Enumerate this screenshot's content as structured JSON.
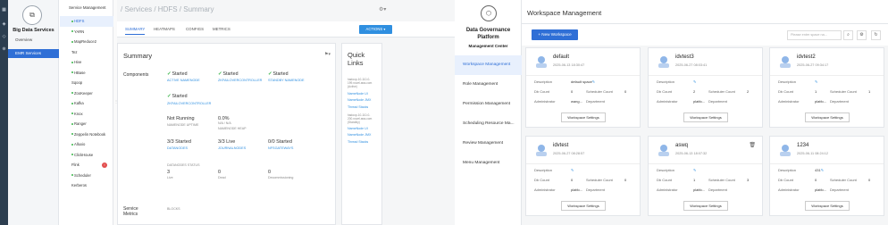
{
  "rail": {
    "icons": [
      "grid-icon",
      "layers-icon",
      "share-icon",
      "cluster-icon"
    ]
  },
  "bigdata": {
    "title": "Big Data Services",
    "nav": [
      {
        "label": "Overview"
      },
      {
        "label": "EMR Services"
      }
    ]
  },
  "services": {
    "heading": "Service Management",
    "items": [
      {
        "label": "HDFS",
        "dot": true
      },
      {
        "label": "YARN",
        "dot": true
      },
      {
        "label": "MapReduce2",
        "dot": true
      },
      {
        "label": "Tez",
        "dot": false
      },
      {
        "label": "Hive",
        "dot": true
      },
      {
        "label": "HBase",
        "dot": true
      },
      {
        "label": "Sqoop",
        "dot": false
      },
      {
        "label": "ZooKeeper",
        "dot": true
      },
      {
        "label": "Kafka",
        "dot": true
      },
      {
        "label": "Knox",
        "dot": true
      },
      {
        "label": "Ranger",
        "dot": true
      },
      {
        "label": "Zeppelin Notebook",
        "dot": true
      },
      {
        "label": "Alluxio",
        "dot": true
      },
      {
        "label": "ClickHouse",
        "dot": true
      },
      {
        "label": "Flink",
        "dot": false
      },
      {
        "label": "Scheduler",
        "dot": true
      },
      {
        "label": "Kerberos",
        "dot": false
      }
    ],
    "flink_badge": "!"
  },
  "hdfs": {
    "breadcrumb": "/ Services / HDFS / Summary",
    "tabs": [
      {
        "label": "SUMMARY"
      },
      {
        "label": "HEATMAPS"
      },
      {
        "label": "CONFIGS"
      },
      {
        "label": "METRICS"
      }
    ],
    "actions_label": "ACTIONS ▾",
    "summary_title": "Summary",
    "components_label": "Components",
    "components": [
      {
        "status": "Started",
        "name": "ACTIVE NAMENODE"
      },
      {
        "status": "Started",
        "name": "ZKFAILOVERCONTROLLER"
      },
      {
        "status": "Started",
        "name": "STANDBY NAMENODE"
      },
      {
        "status": "Started",
        "name": "ZKFAILOVERCONTROLLER"
      }
    ],
    "namenode_uptime": {
      "value": "Not Running",
      "label": "NAMENODE UPTIME"
    },
    "heap": {
      "value": "0.0%",
      "detail": "N/A / N/A",
      "label": "NAMENODE HEAP"
    },
    "datanodes": {
      "value": "3/3 Started",
      "label": "DATANODES"
    },
    "journalnodes": {
      "value": "3/3 Live",
      "label": "JOURNALNODES"
    },
    "nfsgateways": {
      "value": "0/0 Started",
      "label": "NFSGATEWAYS"
    },
    "datanodes_status": {
      "label": "DATANODES STATUS",
      "live": {
        "value": "3",
        "label": "Live"
      },
      "dead": {
        "value": "0",
        "label": "Dead"
      },
      "decom": {
        "value": "0",
        "label": "Decommissioning"
      }
    },
    "service_metrics_label": "Service Metrics",
    "blocks_label": "BLOCKS",
    "quick_links": {
      "title": "Quick Links",
      "host1": "hadoop-10-110-0-199.novel.aws.com (Active)",
      "host1_links": [
        "NameNode UI",
        "NameNode JMX",
        "Thread Stacks"
      ],
      "host2": "hadoop-10-110-0-200.novel.aws.com (Standby)",
      "host2_links": [
        "NameNode UI",
        "NameNode JMX",
        "Thread Stacks"
      ]
    }
  },
  "governance": {
    "title": "Data Governance Platform",
    "subtitle": "Management Center",
    "nav": [
      {
        "label": "Workspace Management"
      },
      {
        "label": "Role Management"
      },
      {
        "label": "Permission Management"
      },
      {
        "label": "Scheduling Resource Ma..."
      },
      {
        "label": "Review Management"
      },
      {
        "label": "Menu Management"
      }
    ],
    "page_title": "Workspace Management",
    "new_button": "+ New Workspace",
    "search_placeholder": "Please enter space na...",
    "labels": {
      "description": "Description",
      "db_count": "Db Count",
      "scheduler_count": "Scheduler Count",
      "administrator": "Administrator",
      "department": "Department",
      "settings_button": "Workspace Settings"
    },
    "workspaces": [
      {
        "name": "default",
        "date": "2025-06-13 18:30:47",
        "description": "default space",
        "db": "0",
        "scheduler": "0",
        "admin": "wang..."
      },
      {
        "name": "idvtest3",
        "date": "2025-06-27 08:03:41",
        "description": "",
        "db": "2",
        "scheduler": "2",
        "admin": "platfo..."
      },
      {
        "name": "idvtest2",
        "date": "2025-06-27 09:34:17",
        "description": "",
        "db": "1",
        "scheduler": "1",
        "admin": "platfo..."
      },
      {
        "name": "idvtest",
        "date": "2025-06-27 08:28:57",
        "description": "",
        "db": "0",
        "scheduler": "0",
        "admin": "platfo..."
      },
      {
        "name": "aswq",
        "date": "2025-06-13 18:07:32",
        "description": "",
        "db": "1",
        "scheduler": "3",
        "admin": "platfo..."
      },
      {
        "name": "1234",
        "date": "2025-06-11 08:24:12",
        "description": "431",
        "db": "0",
        "scheduler": "0",
        "admin": "platfo..."
      }
    ]
  }
}
